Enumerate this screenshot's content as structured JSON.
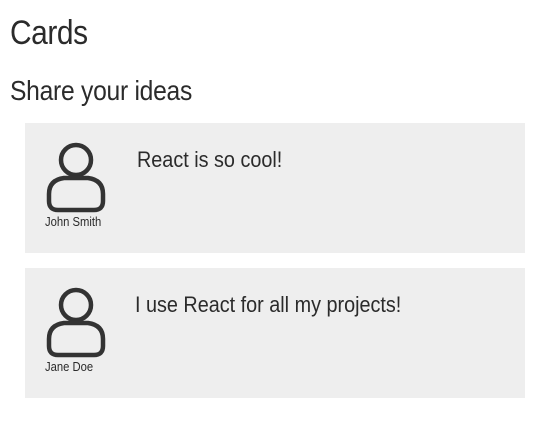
{
  "page": {
    "title": "Cards",
    "subtitle": "Share your ideas"
  },
  "cards": [
    {
      "author": "John Smith",
      "message": "React is so cool!",
      "avatar_icon": "user-icon"
    },
    {
      "author": "Jane Doe",
      "message": "I use React for all my projects!",
      "avatar_icon": "user-icon"
    }
  ],
  "colors": {
    "text": "#2b2b2b",
    "card_background": "#eeeeee",
    "icon_stroke": "#333333"
  }
}
